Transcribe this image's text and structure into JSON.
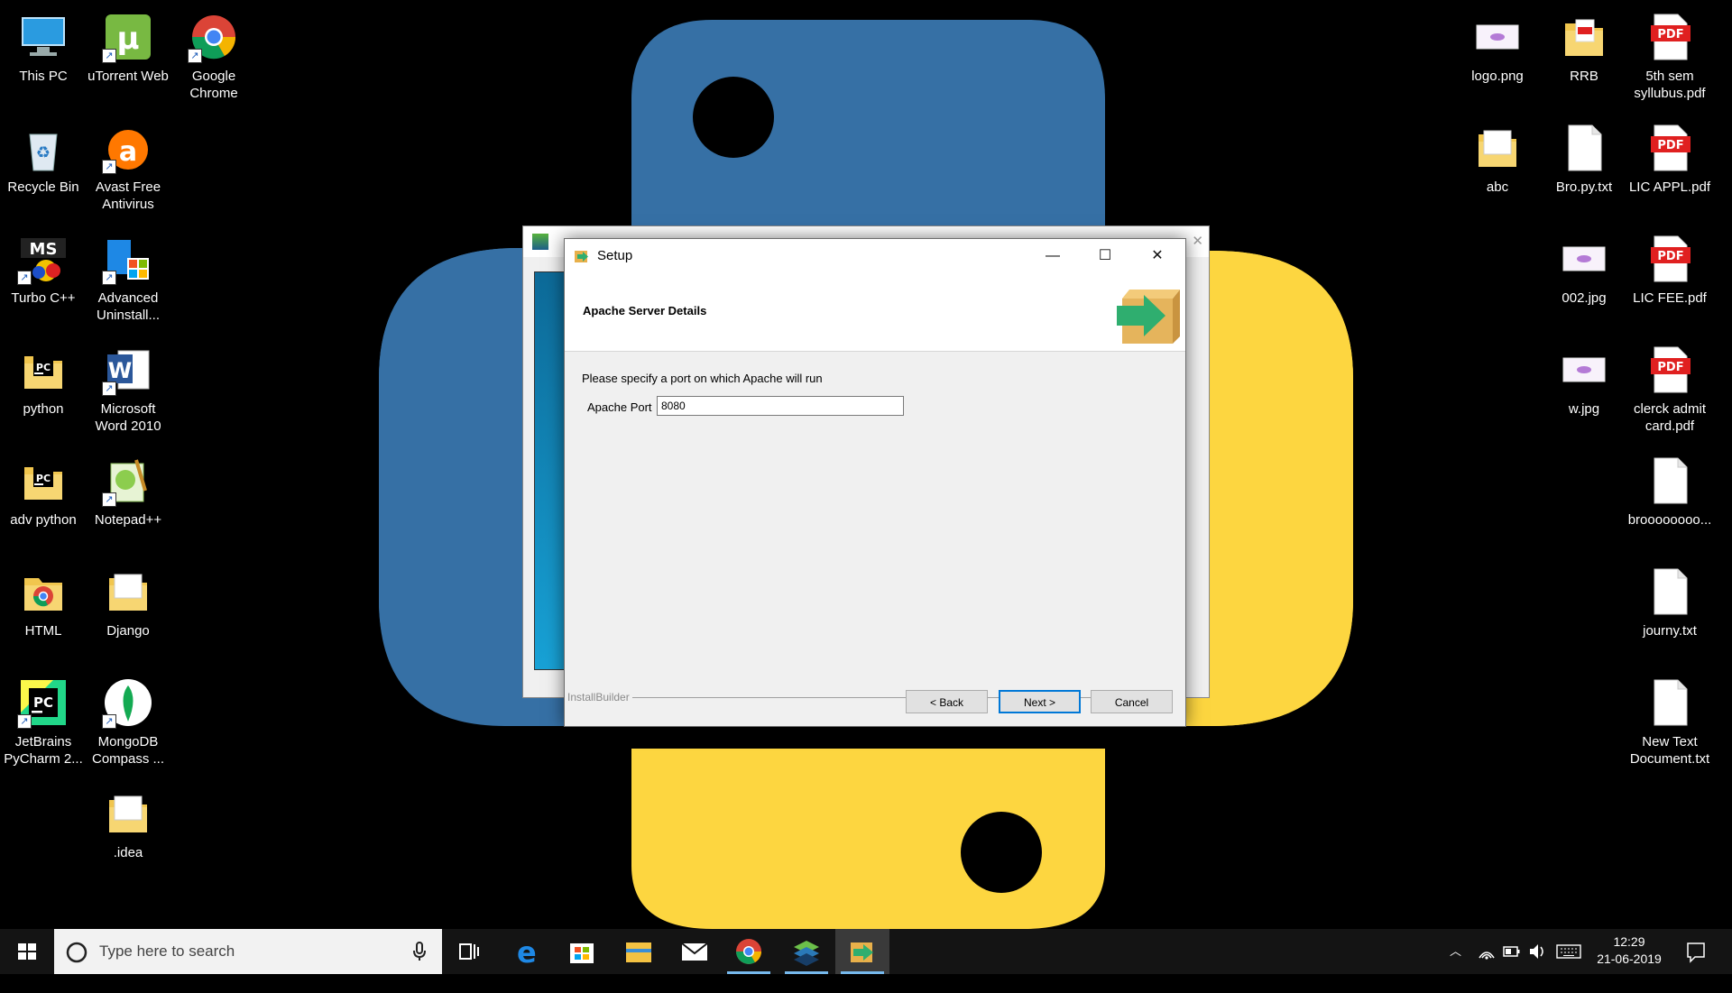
{
  "desktop": {
    "left_icons": [
      {
        "label": "This PC",
        "icon": "this-pc-icon"
      },
      {
        "label": "uTorrent Web",
        "icon": "utorrent-icon"
      },
      {
        "label": "Google Chrome",
        "icon": "chrome-icon"
      },
      {
        "label": "Recycle Bin",
        "icon": "recycle-bin-icon"
      },
      {
        "label": "Avast Free Antivirus",
        "icon": "avast-icon"
      },
      {
        "label": "Turbo C++",
        "icon": "turbo-cpp-icon"
      },
      {
        "label": "Advanced Uninstall...",
        "icon": "advanced-uninstaller-icon"
      },
      {
        "label": "python",
        "icon": "pycharm-folder-icon"
      },
      {
        "label": "Microsoft Word 2010",
        "icon": "word-icon"
      },
      {
        "label": "adv python",
        "icon": "pycharm-folder-icon"
      },
      {
        "label": "Notepad++",
        "icon": "notepad-plus-plus-icon"
      },
      {
        "label": "HTML",
        "icon": "chrome-folder-icon"
      },
      {
        "label": "Django",
        "icon": "folder-icon"
      },
      {
        "label": "JetBrains PyCharm 2...",
        "icon": "pycharm-icon"
      },
      {
        "label": "MongoDB Compass ...",
        "icon": "mongodb-icon"
      },
      {
        "label": ".idea",
        "icon": "folder-icon"
      }
    ],
    "right_icons": [
      {
        "label": "logo.png",
        "icon": "image-file-icon"
      },
      {
        "label": "RRB",
        "icon": "pdf-folder-icon"
      },
      {
        "label": "5th sem syllubus.pdf",
        "icon": "pdf-icon"
      },
      {
        "label": "abc",
        "icon": "folder-icon"
      },
      {
        "label": "Bro.py.txt",
        "icon": "text-file-icon"
      },
      {
        "label": "LIC APPL.pdf",
        "icon": "pdf-icon"
      },
      {
        "label": "002.jpg",
        "icon": "image-file-icon"
      },
      {
        "label": "LIC FEE.pdf",
        "icon": "pdf-icon"
      },
      {
        "label": "w.jpg",
        "icon": "image-file-icon"
      },
      {
        "label": "clerck admit card.pdf",
        "icon": "pdf-icon"
      },
      {
        "label": "broooooooo...",
        "icon": "text-file-icon"
      },
      {
        "label": "journy.txt",
        "icon": "text-file-icon"
      },
      {
        "label": "New Text Document.txt",
        "icon": "text-file-icon"
      }
    ],
    "pdf_badge": "PDF"
  },
  "setup_dialog": {
    "title": "Setup",
    "header_title": "Apache Server Details",
    "prompt": "Please specify a port on which Apache will run",
    "port_label": "Apache Port",
    "port_value": "8080",
    "brand": "InstallBuilder",
    "back_label": "< Back",
    "next_label": "Next >",
    "cancel_label": "Cancel",
    "minimize_glyph": "—",
    "maximize_glyph": "☐",
    "close_glyph": "✕"
  },
  "taskbar": {
    "search_placeholder": "Type here to search",
    "time": "12:29",
    "date": "21-06-2019",
    "accent": "#76b9ed",
    "apps": [
      "task-view-icon",
      "edge-icon",
      "store-icon",
      "file-explorer-icon",
      "mail-icon",
      "chrome-icon",
      "bitnami-stack-icon",
      "setup-icon"
    ]
  },
  "colors": {
    "python_blue": "#3670a5",
    "python_yellow": "#fdd640",
    "focus_blue": "#0078d7"
  }
}
